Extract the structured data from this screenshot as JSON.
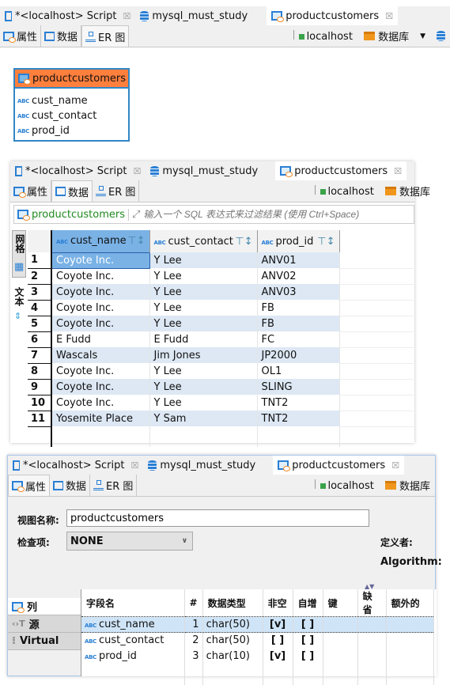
{
  "editor_tabs": [
    {
      "label": "*<localhost> Script",
      "icon": "script-icon",
      "closable": true
    },
    {
      "label": "mysql_must_study",
      "icon": "database-icon",
      "closable": false
    },
    {
      "label": "productcustomers",
      "icon": "view-icon",
      "closable": true
    }
  ],
  "sub_tabs": [
    {
      "label": "属性",
      "icon": "properties-icon"
    },
    {
      "label": "数据",
      "icon": "data-icon"
    },
    {
      "label": "ER 图",
      "icon": "er-diagram-icon"
    }
  ],
  "toolbar": {
    "connection": "localhost",
    "catalog": "数据库"
  },
  "er": {
    "table": "productcustomers",
    "fields": [
      "cust_name",
      "cust_contact",
      "prod_id"
    ]
  },
  "data_view": {
    "filter_entity": "productcustomers",
    "filter_placeholder": "输入一个 SQL 表达式来过滤结果 (使用 Ctrl+Space)",
    "side_tabs": [
      "网格",
      "文本"
    ],
    "columns": [
      "cust_name",
      "cust_contact",
      "prod_id"
    ],
    "rows": [
      [
        "1",
        "Coyote Inc.",
        "Y Lee",
        "ANV01"
      ],
      [
        "2",
        "Coyote Inc.",
        "Y Lee",
        "ANV02"
      ],
      [
        "3",
        "Coyote Inc.",
        "Y Lee",
        "ANV03"
      ],
      [
        "4",
        "Coyote Inc.",
        "Y Lee",
        "FB"
      ],
      [
        "5",
        "Coyote Inc.",
        "Y Lee",
        "FB"
      ],
      [
        "6",
        "E Fudd",
        "E Fudd",
        "FC"
      ],
      [
        "7",
        "Wascals",
        "Jim Jones",
        "JP2000"
      ],
      [
        "8",
        "Coyote Inc.",
        "Y Lee",
        "OL1"
      ],
      [
        "9",
        "Coyote Inc.",
        "Y Lee",
        "SLING"
      ],
      [
        "10",
        "Coyote Inc.",
        "Y Lee",
        "TNT2"
      ],
      [
        "11",
        "Yosemite Place",
        "Y Sam",
        "TNT2"
      ]
    ]
  },
  "props": {
    "view_name_label": "视图名称:",
    "view_name": "productcustomers",
    "check_label": "检查项:",
    "check_value": "NONE",
    "definer_label": "定义者:",
    "algorithm_label": "Algorithm:",
    "left_tabs": [
      "列",
      "源",
      "Virtual"
    ],
    "col_headers": [
      "字段名",
      "#",
      "数据类型",
      "非空",
      "自增",
      "键",
      "缺省",
      "额外的"
    ],
    "col_rows": [
      [
        "cust_name",
        "1",
        "char(50)",
        "[v]",
        "[ ]",
        "",
        "",
        ""
      ],
      [
        "cust_contact",
        "2",
        "char(50)",
        "[ ]",
        "[ ]",
        "",
        "",
        ""
      ],
      [
        "prod_id",
        "3",
        "char(10)",
        "[v]",
        "[ ]",
        "",
        "",
        ""
      ]
    ]
  }
}
